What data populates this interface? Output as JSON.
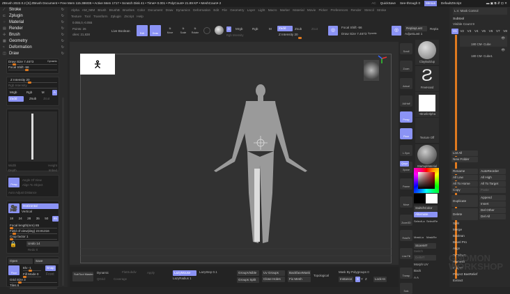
{
  "titlebar": {
    "text": "ZBrush 2022.0.2 [S]  ZBrush Document    • Free Mem 115.386GB • Active Mem 1717 • Scratch Disk 41 • Timer• 0.001 • PolyCount• 21.89 KP • MeshCount• 2",
    "ac": "AC",
    "quicksave": "QuickSave",
    "seethrough": "See-through 0",
    "menus": "Menus",
    "script": "DefaultZScript"
  },
  "left_menus": [
    "Stroke",
    "Zplugin",
    "Material",
    "Render",
    "Brush",
    "Geometry",
    "Deformation",
    "Draw"
  ],
  "draw": {
    "draw_size": "Draw Size 7.4673",
    "dynamic": "Dynamic",
    "focal_shift": "Focal Shift -56",
    "z_intensity": "Z Intensity 20",
    "rgb_intensity": "Rgb Intensity",
    "mrgb": "Mrgb",
    "rgb": "Rgb",
    "m": "M",
    "a": "A",
    "zadd": "Zadd",
    "zsub": "Zsub",
    "zcut": "Zcut",
    "width": "Width",
    "height": "Height",
    "depth": "Depth",
    "imbed": "Imbed",
    "persp": "Persp",
    "angle_of_view": "Angle Of View",
    "align_to_object": "Align To Object",
    "auto_adjust": "Auto Adjust Distance",
    "horizontal": "Horizontal",
    "vertical": "Vertical",
    "focal_presets": [
      "18",
      "24",
      "28",
      "35",
      "50",
      "85"
    ],
    "focal_length": "Focal length(mm) 85",
    "fov": "Field of view(deg) 23.91316",
    "crop": "Crop factor 1",
    "undo": "Undo 14",
    "redo": "Redo 0",
    "open": "Open",
    "save": "Save",
    "floor": "Floor",
    "elv": "Elv -1",
    "snap": "Snap",
    "fill_mode": "Fill Mode 0",
    "front": "Front",
    "grid_size": "Grid Size 3",
    "tiles": "Tiles 6"
  },
  "top_menu_row1": "Alpha  AM_IMM  Brush  BrushB  Brushes  Color  Document  Draw  Dynamics  Deformation  Edit  File  Geometry  Layer  Light  Macro  Marker  Material  Movie  Picker  Preferences  Render  Stencil  Stroke",
  "top_menu_row2": "Texture  Tool  Transform  Zplugin  Zscript  Help",
  "info": {
    "coords": "0.055,0,-0.055",
    "points": "Points: 26",
    "polys": "olies: 21,838"
  },
  "toolbar": {
    "live_boolean": "Live Boolean",
    "edit": "Edit",
    "draw": "Draw",
    "move": "Move",
    "scale": "Scale",
    "rotate": "Rotate",
    "a": "A",
    "mrgb": "Mrgb",
    "rgb": "Rgb",
    "m": "M",
    "zadd": "Zadd",
    "zsub": "Zsub",
    "zcut": "Zcut",
    "rgb_intensity": "Rgb Intensity",
    "z_intensity": "Z Intensity 20",
    "focal_shift": "Focal Shift -56",
    "draw_size": "Draw Size 7.4673",
    "dynamic": "Dynamic",
    "replay_last": "ReplayLast",
    "replay": "Repla",
    "adjust_last": "AdjustLast 1"
  },
  "shelf": [
    "Scroll",
    "Zoom",
    "Actual",
    "AAHalf",
    "Persp",
    "Floor",
    "L.Sym",
    "Xpose",
    "Frame",
    "Move",
    "Zoom3D",
    "RotaTe",
    "Line Fill",
    "Transp",
    "Solo"
  ],
  "shelf_xyz": "Qxyz",
  "thumbs": {
    "brush": "ClayBuildup",
    "stroke": "FreeHand",
    "alpha": "~BrushAlpha",
    "texture": "Texture Off",
    "material": "StartupMaterial",
    "switch_color": "SwitchColor",
    "alternate": "Alternate",
    "select_lasso": "SelectLa",
    "select_rect": "SelectRe",
    "maskla": "MaskLa",
    "maskre": "MaskRe",
    "storemt": "StoreMT",
    "switch": "Switch",
    "delmt": "DelMT",
    "morph_uv": "Morph UV",
    "back": "Back",
    "aa": "A A"
  },
  "subtool": {
    "header": "L.V. Mask Control",
    "title": "Subtool",
    "visible_count": "Visible Count 9",
    "vtabs": [
      "V1",
      "V2",
      "V3",
      "V4",
      "V5",
      "V6",
      "V7",
      "V8"
    ],
    "items": [
      "180 CM- Cube",
      "180 CM- Cube1"
    ],
    "buttons": [
      "List All",
      "New Folder",
      "Rename",
      "AutoReorder",
      "All Low",
      "All High",
      "All To Home",
      "All To Target",
      "Copy",
      "Paste",
      "Duplicate",
      "Append",
      "Insert",
      "Delete",
      "Del Other",
      "Del All"
    ],
    "actions": [
      "Split",
      "Merge",
      "Boolean",
      "Bevel Pro",
      "Align",
      "Distribute",
      "Remesh",
      "Project",
      "Project BasRelief",
      "Extract"
    ]
  },
  "bottom": {
    "subtool_master": "SubTool Master",
    "dynamic": "Dynamic",
    "flatsubdiv": "FlatSubdiv",
    "apply": "Apply",
    "qgrid": "QGrid",
    "coverage": "Coverage",
    "lazymouse": "LazyMouse",
    "lazystep": "LazyStep 0.1",
    "lazyradius": "LazyRadius 1",
    "groupvisible": "GroupVisible",
    "uv_groups": "Uv Groups",
    "backfacemask": "BackfaceMask",
    "topological": "Topological",
    "groups_split": "Groups Split",
    "close_holes": "Close Holes",
    "fix_mesh": "Fix Mesh",
    "mask_by_polygroups": "Mask By Polygroups 0",
    "instance": "Instance",
    "x": "X",
    "y": "Y",
    "z": "Z",
    "lock_in": "Lock-In"
  },
  "watermark": "THE GNOMON WORKSHOP"
}
